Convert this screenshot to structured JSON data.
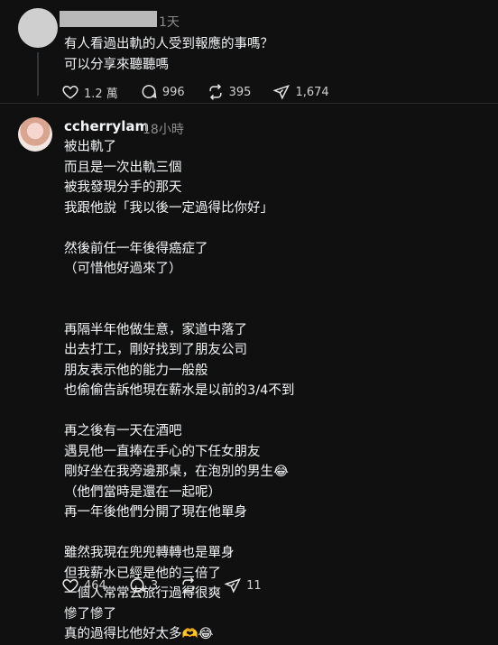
{
  "post": {
    "time": "1天",
    "lines": "有人看過出軌的人受到報應的事嗎？\n可以分享來聽聽嗎",
    "likes": "1.2 萬",
    "comments": "996",
    "reposts": "395",
    "shares": "1,674"
  },
  "reply": {
    "username": "ccherrylam",
    "time": "18小時",
    "lines": "被出軌了\n而且是一次出軌三個\n被我發現分手的那天\n我跟他說「我以後一定過得比你好」\n\n然後前任一年後得癌症了\n（可惜他好過來了）\n\n\n再隔半年他做生意，家道中落了\n出去打工，剛好找到了朋友公司\n朋友表示他的能力一般般\n也偷偷告訴他現在薪水是以前的3/4不到\n\n再之後有一天在酒吧\n遇見他一直捧在手心的下任女朋友\n剛好坐在我旁邊那桌，在泡別的男生😂\n（他們當時是還在一起呢）\n再一年後他們分開了現在他單身\n\n雖然我現在兜兜轉轉也是單身\n但我薪水已經是他的三倍了\n一個人常常去旅行過得很爽\n慘了慘了\n真的過得比他好太多🫶😂",
    "likes": "464",
    "comments": "3",
    "reposts": "",
    "shares": "11"
  }
}
